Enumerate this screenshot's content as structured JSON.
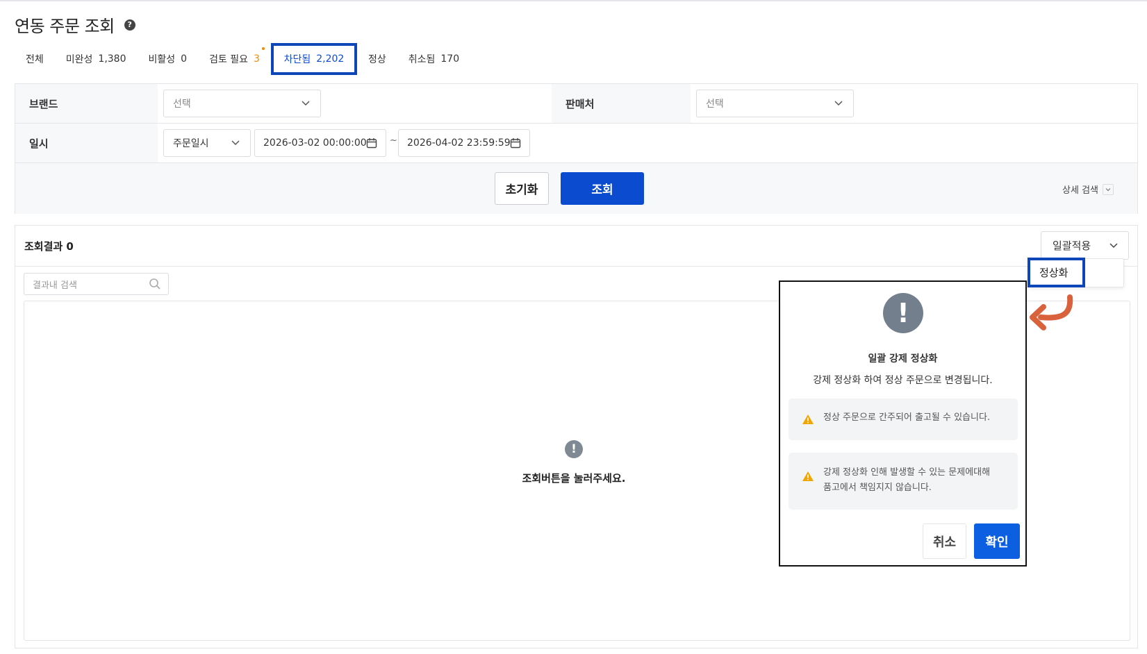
{
  "page": {
    "title": "연동 주문 조회",
    "help_icon": "?"
  },
  "tabs": [
    {
      "label": "전체",
      "count": ""
    },
    {
      "label": "미완성",
      "count": "1,380"
    },
    {
      "label": "비활성",
      "count": "0"
    },
    {
      "label": "검토 필요",
      "count": "3"
    },
    {
      "label": "차단됨",
      "count": "2,202"
    },
    {
      "label": "정상",
      "count": ""
    },
    {
      "label": "취소됨",
      "count": "170"
    }
  ],
  "filters": {
    "brand_label": "브랜드",
    "brand_placeholder": "선택",
    "seller_label": "판매처",
    "seller_placeholder": "선택",
    "date_label": "일시",
    "date_type": "주문일시",
    "date_from": "2026-03-02 00:00:00",
    "date_tilde": "~",
    "date_to": "2026-04-02 23:59:59",
    "reset_label": "초기화",
    "search_label": "조회",
    "detail_search_label": "상세 검색"
  },
  "results": {
    "title": "조회결과 0",
    "bulk_label": "일괄적용",
    "bulk_option": "정상화",
    "inner_search_placeholder": "결과내 검색",
    "empty_icon": "!",
    "empty_text": "조회버튼을 눌러주세요."
  },
  "modal": {
    "icon": "!",
    "title": "일괄 강제 정상화",
    "description": "강제 정상화 하여 정상 주문으로 변경됩니다.",
    "warning1": "정상 주문으로 간주되어 출고될 수 있습니다.",
    "warning2_line1": "강제 정상화 인해 발생할 수 있는 문제에대해",
    "warning2_line2": "품고에서 책임지지 않습니다.",
    "cancel_label": "취소",
    "confirm_label": "확인"
  },
  "colors": {
    "primary": "#0b4bd0",
    "highlight_border": "#0c46b8",
    "arrow": "#d9613c",
    "warning": "#f0a500",
    "review_count": "#f08c00"
  }
}
